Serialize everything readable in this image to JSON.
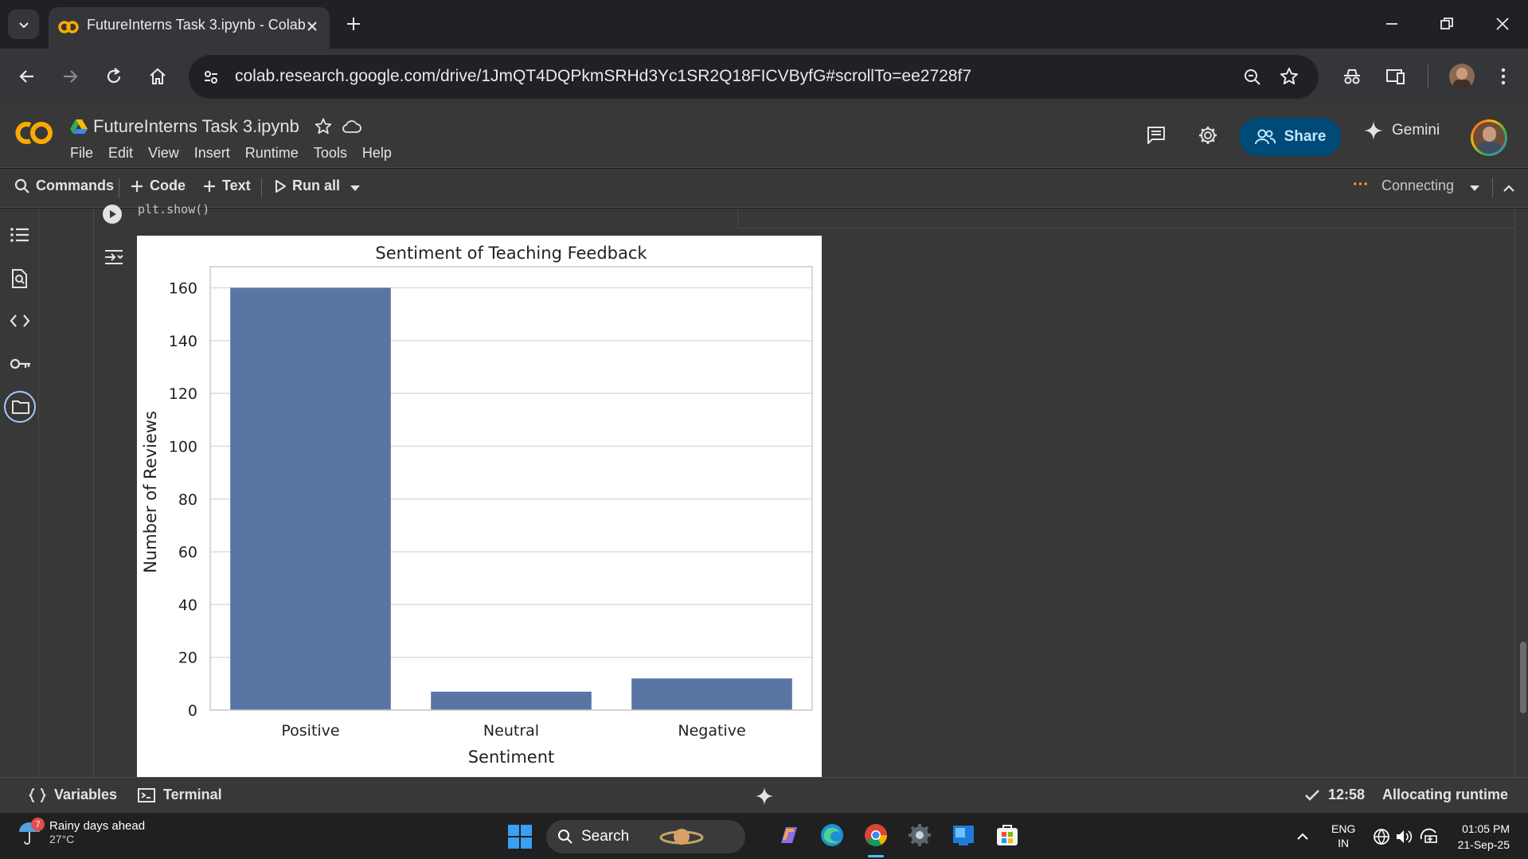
{
  "browser": {
    "tab_title": "FutureInterns Task 3.ipynb - Colab",
    "url": "colab.research.google.com/drive/1JmQT4DQPkmSRHd3Yc1SR2Q18FICVByfG#scrollTo=ee2728f7"
  },
  "colab": {
    "logo_text": "CO",
    "notebook_title": "FutureInterns Task 3.ipynb",
    "menu": [
      "File",
      "Edit",
      "View",
      "Insert",
      "Runtime",
      "Tools",
      "Help"
    ],
    "share_label": "Share",
    "gemini_label": "Gemini",
    "toolbar": {
      "commands": "Commands",
      "code": "Code",
      "text": "Text",
      "run_all": "Run all",
      "connecting": "Connecting",
      "connecting_dots": "···"
    },
    "code_tail": "plt.show()",
    "status": {
      "variables": "Variables",
      "terminal": "Terminal",
      "time": "12:58",
      "runtime": "Allocating runtime"
    }
  },
  "chart_data": {
    "type": "bar",
    "title": "Sentiment of Teaching Feedback",
    "xlabel": "Sentiment",
    "ylabel": "Number of Reviews",
    "categories": [
      "Positive",
      "Neutral",
      "Negative"
    ],
    "values": [
      160,
      7,
      12
    ],
    "ylim": [
      0,
      168
    ],
    "yticks": [
      0,
      20,
      40,
      60,
      80,
      100,
      120,
      140,
      160
    ],
    "grid": true,
    "bar_color": "#5975a4"
  },
  "taskbar": {
    "weather_title": "Rainy days ahead",
    "weather_temp": "27°C",
    "weather_badge": "7",
    "search_label": "Search",
    "lang_line1": "ENG",
    "lang_line2": "IN",
    "clock_time": "01:05 PM",
    "clock_date": "21-Sep-25"
  }
}
